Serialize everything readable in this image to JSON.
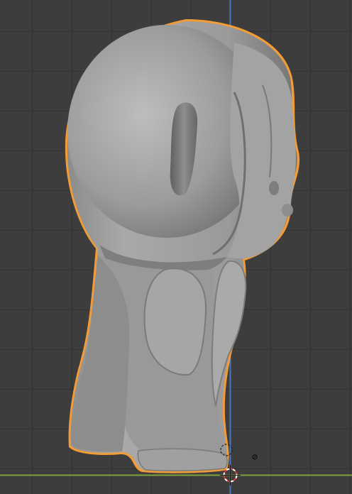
{
  "viewport": {
    "background_color": "#3d3d3d",
    "grid_color": "#333333",
    "axis_z_color": "#4b78c2",
    "axis_y_color": "#7fa33c",
    "selection_outline_color": "#f29c38",
    "mesh_color": "#9a9a9a",
    "cursor_icon": "3d-cursor-icon",
    "origin_icon": "object-origin-icon",
    "light_icon": "light-icon"
  }
}
